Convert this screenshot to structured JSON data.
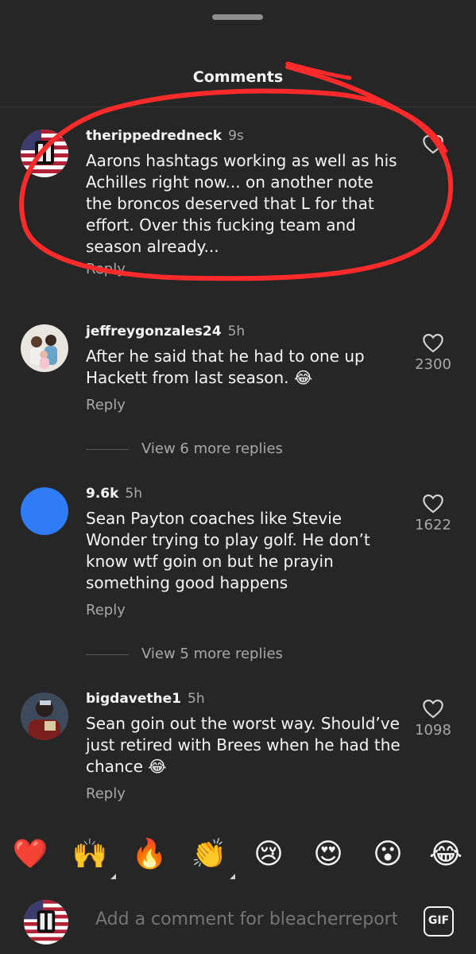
{
  "header": {
    "title": "Comments"
  },
  "comments": [
    {
      "username": "therippedredneck",
      "time": "9s",
      "text": "Aarons hashtags working as well as his Achilles right now... on another note the broncos deserved that L for that effort. Over this fucking team and season already...",
      "reply": "Reply",
      "likes": "",
      "avatar": "flag-skull-avatar"
    },
    {
      "username": "jeffreygonzales24",
      "time": "5h",
      "text": "After he said that he had to one up Hackett from last season. 😂",
      "reply": "Reply",
      "likes": "2300",
      "view_more": "View 6 more replies",
      "avatar": "family-photo-avatar"
    },
    {
      "username": "9.6k",
      "time": "5h",
      "text": "Sean Payton coaches like Stevie Wonder trying to play golf. He don’t know wtf goin on but he prayin something good happens",
      "reply": "Reply",
      "likes": "1622",
      "view_more": "View 5 more replies",
      "avatar": "blue-circle-avatar"
    },
    {
      "username": "bigdavethe1",
      "time": "5h",
      "text": "Sean goin out the worst way. Should’ve just retired with Brees when he had the chance 😂",
      "reply": "Reply",
      "likes": "1098",
      "avatar": "person-photo-avatar"
    }
  ],
  "emoji_bar": [
    "❤️",
    "🙌",
    "🔥",
    "👏",
    "😢",
    "😍",
    "😮",
    "😂"
  ],
  "composer": {
    "placeholder": "Add a comment for bleacherreport…",
    "gif_label": "GIF"
  },
  "colors": {
    "background": "#262626",
    "secondary_text": "#a8a8a8",
    "annotation": "#ff2a2a",
    "avatar_blue": "#2f7cf6"
  }
}
